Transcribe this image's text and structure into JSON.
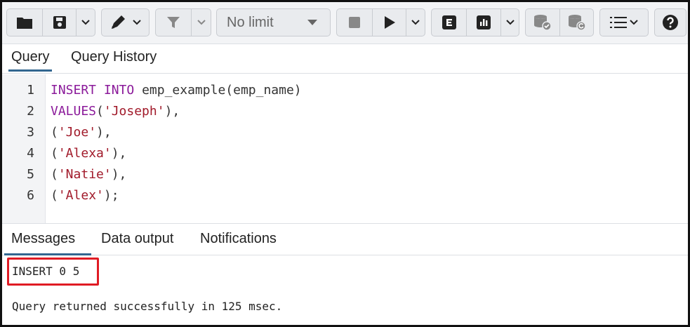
{
  "toolbar": {
    "limit_label": "No limit",
    "buttons": [
      {
        "icon": "folder-icon"
      },
      {
        "icon": "save-icon"
      },
      {
        "icon": "edit-icon"
      },
      {
        "icon": "filter-icon"
      },
      {
        "icon": "stop-icon"
      },
      {
        "icon": "play-icon"
      },
      {
        "icon": "explain-icon"
      },
      {
        "icon": "explain-analyze-icon"
      },
      {
        "icon": "commit-icon"
      },
      {
        "icon": "rollback-icon"
      },
      {
        "icon": "macros-icon"
      },
      {
        "icon": "help-icon"
      }
    ]
  },
  "query_tabs": [
    "Query",
    "Query History"
  ],
  "editor": {
    "line_numbers": [
      "1",
      "2",
      "3",
      "4",
      "5",
      "6"
    ],
    "lines": [
      [
        {
          "t": "kw",
          "v": "INSERT"
        },
        {
          "t": "p",
          "v": " "
        },
        {
          "t": "kw",
          "v": "INTO"
        },
        {
          "t": "p",
          "v": " emp_example(emp_name)"
        }
      ],
      [
        {
          "t": "kw",
          "v": "VALUES"
        },
        {
          "t": "p",
          "v": "("
        },
        {
          "t": "str",
          "v": "'Joseph'"
        },
        {
          "t": "p",
          "v": "),"
        }
      ],
      [
        {
          "t": "p",
          "v": "("
        },
        {
          "t": "str",
          "v": "'Joe'"
        },
        {
          "t": "p",
          "v": "),"
        }
      ],
      [
        {
          "t": "p",
          "v": "("
        },
        {
          "t": "str",
          "v": "'Alexa'"
        },
        {
          "t": "p",
          "v": "),"
        }
      ],
      [
        {
          "t": "p",
          "v": "("
        },
        {
          "t": "str",
          "v": "'Natie'"
        },
        {
          "t": "p",
          "v": "),"
        }
      ],
      [
        {
          "t": "p",
          "v": "("
        },
        {
          "t": "str",
          "v": "'Alex'"
        },
        {
          "t": "p",
          "v": ");"
        }
      ]
    ]
  },
  "bottom_tabs": [
    "Messages",
    "Data output",
    "Notifications"
  ],
  "messages": {
    "result": "INSERT 0 5",
    "status": "Query returned successfully in 125 msec."
  },
  "colors": {
    "keyword": "#8b1a9a",
    "string": "#a11a2a",
    "highlight": "#e01b24",
    "active_tab": "#326690"
  }
}
